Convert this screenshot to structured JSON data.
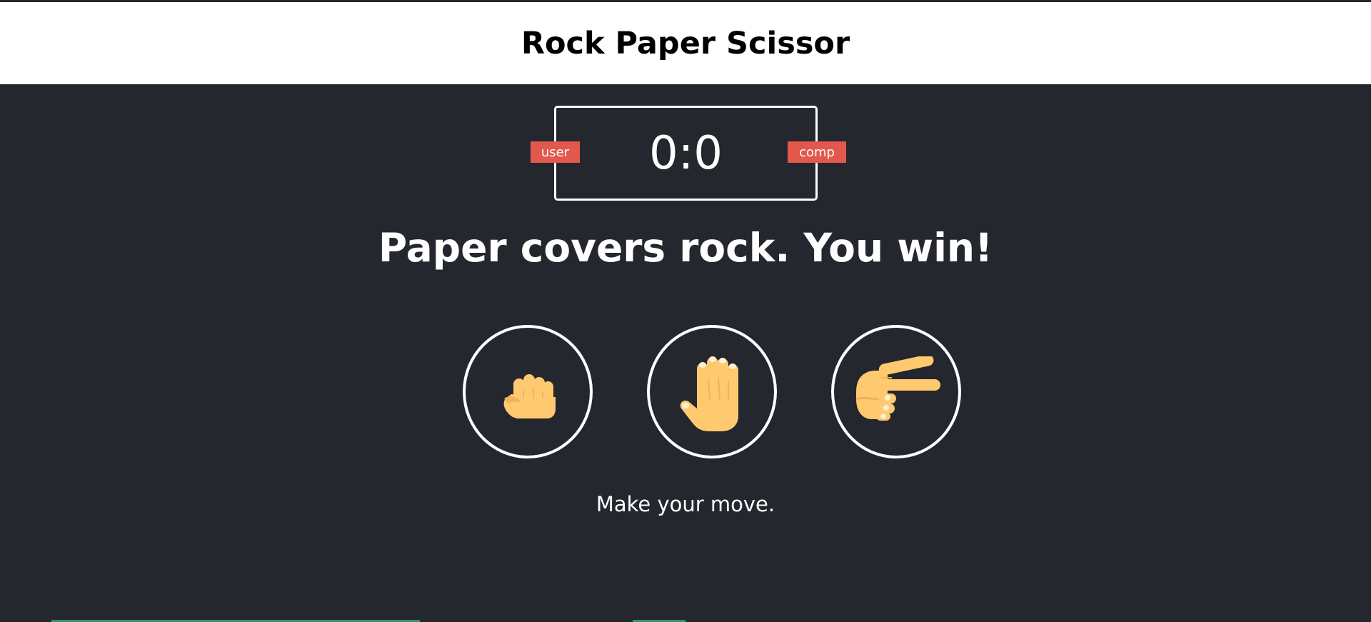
{
  "header": {
    "title": "Rock Paper Scissor"
  },
  "scoreboard": {
    "score": "0:0",
    "user_label": "user",
    "comp_label": "comp"
  },
  "result": {
    "message": "Paper covers rock. You win!"
  },
  "choices": [
    {
      "name": "rock",
      "icon": "raised-fist-icon"
    },
    {
      "name": "paper",
      "icon": "raised-hand-icon"
    },
    {
      "name": "scissors",
      "icon": "victory-hand-icon"
    }
  ],
  "action": {
    "message": "Make your move."
  },
  "colors": {
    "background": "#24272e",
    "badge": "#e2584d",
    "skin": "#ffc970",
    "white": "#ffffff"
  }
}
